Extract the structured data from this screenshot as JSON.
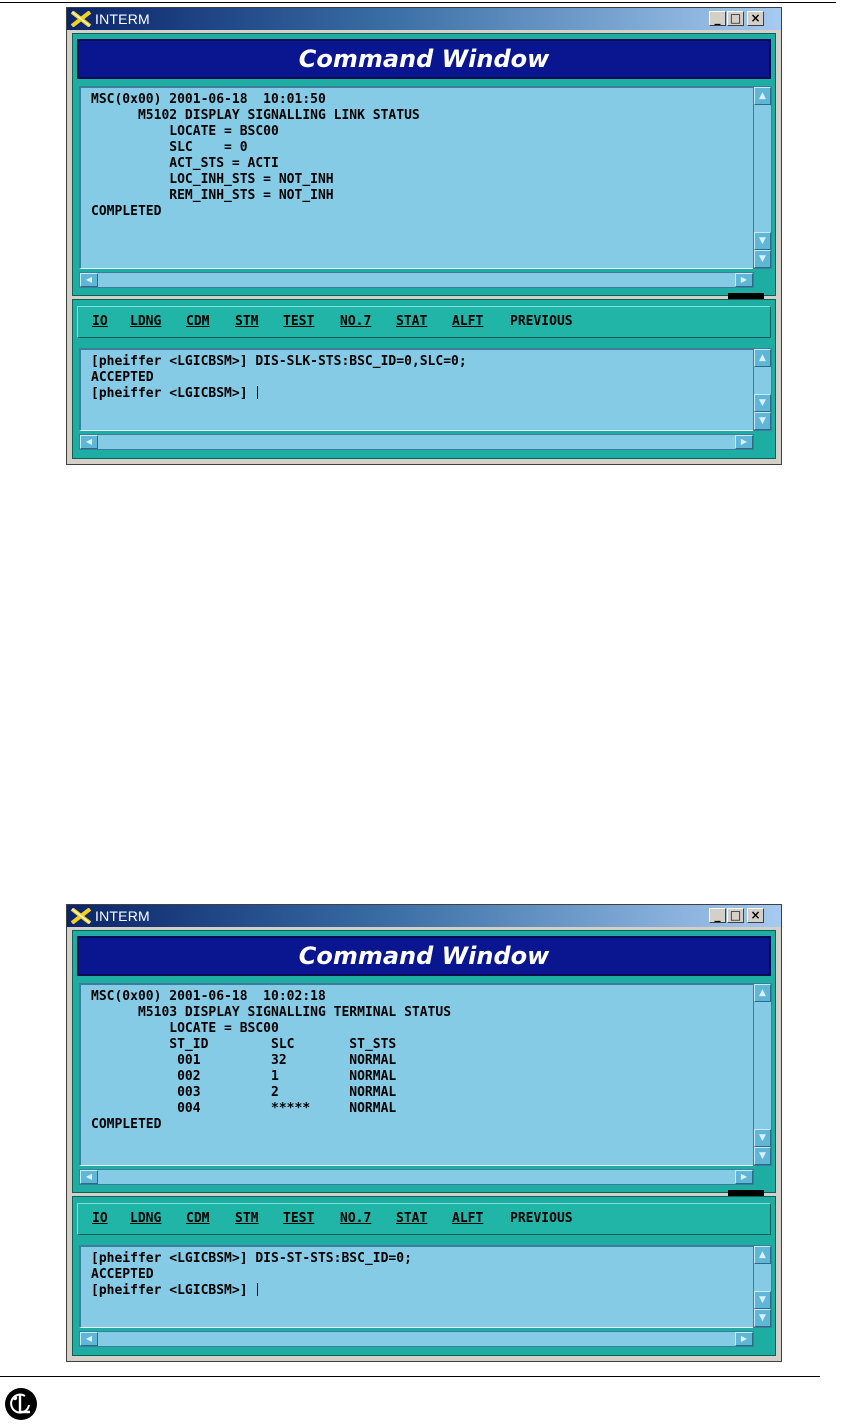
{
  "windows": [
    {
      "title": "INTERM",
      "header": "Command Window",
      "output_lines": [
        "MSC(0x00) 2001-06-18  10:01:50",
        "      M5102 DISPLAY SIGNALLING LINK STATUS",
        "          LOCATE = BSC00",
        "          SLC    = 0",
        "          ACT_STS = ACTI",
        "          LOC_INH_STS = NOT_INH",
        "          REM_INH_STS = NOT_INH",
        "COMPLETED"
      ],
      "menu": [
        "IO",
        "LDNG",
        "CDM",
        "STM",
        "TEST",
        "NO.7",
        "STAT",
        "ALFT",
        "PREVIOUS"
      ],
      "input_lines": [
        "[pheiffer <LGICBSM>] DIS-SLK-STS:BSC_ID=0,SLC=0;",
        "ACCEPTED",
        "[pheiffer <LGICBSM>] "
      ]
    },
    {
      "title": "INTERM",
      "header": "Command Window",
      "output_lines": [
        "MSC(0x00) 2001-06-18  10:02:18",
        "      M5103 DISPLAY SIGNALLING TERMINAL STATUS",
        "          LOCATE = BSC00",
        "          ST_ID        SLC       ST_STS",
        "           001         32        NORMAL",
        "           002         1         NORMAL",
        "           003         2         NORMAL",
        "           004         *****     NORMAL",
        "COMPLETED"
      ],
      "menu": [
        "IO",
        "LDNG",
        "CDM",
        "STM",
        "TEST",
        "NO.7",
        "STAT",
        "ALFT",
        "PREVIOUS"
      ],
      "input_lines": [
        "[pheiffer <LGICBSM>] DIS-ST-STS:BSC_ID=0;",
        "ACCEPTED",
        "[pheiffer <LGICBSM>] "
      ]
    }
  ],
  "window_controls": {
    "minimize": "_",
    "maximize": "□",
    "close": "×"
  },
  "icons": {
    "title_icon": "x-logo-icon",
    "footer_logo": "lg-logo-icon"
  },
  "colors": {
    "panel": "#1eada2",
    "text_area": "#85cbe6",
    "header": "#0a1590"
  }
}
